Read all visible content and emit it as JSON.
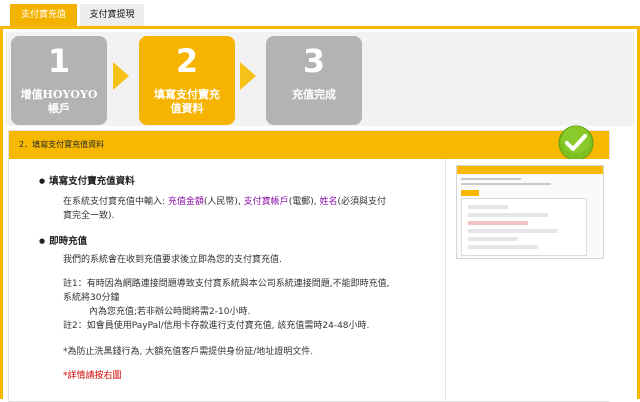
{
  "tabs": [
    {
      "label": "支付寶充值",
      "active": true
    },
    {
      "label": "支付寶提現",
      "active": false
    }
  ],
  "steps": [
    {
      "number": "1",
      "label_line1": "增值HOYOYO",
      "label_line2": "帳戶",
      "state": "done"
    },
    {
      "number": "2",
      "label_line1": "填寫支付寶充",
      "label_line2": "值資料",
      "state": "current"
    },
    {
      "number": "3",
      "label_line1": "充值完成",
      "label_line2": "",
      "state": "pending"
    }
  ],
  "section": {
    "header": "2．填寫支付寶充值資料",
    "bullet1_title": "填寫支付寶充值資料",
    "bullet1_text_prefix": "在系統支付寶充值中輸入: ",
    "bullet1_link_amount": "充值金額",
    "bullet1_text_rmb": "(人民幣), ",
    "bullet1_link_account": "支付寶帳戶",
    "bullet1_text_email": "(電郵), ",
    "bullet1_link_name": "姓名",
    "bullet1_text_suffix": "(必須與支付",
    "bullet1_text_line2": "寶完全一致).",
    "bullet2_title": "即時充值",
    "bullet2_text": "我們的系統會在收到充值要求後立即為您的支付寶充值.",
    "note1_line1": "註1：有時因為網路連接問題導致支付寶系統與本公司系統連接問題,不能即時充值,",
    "note1_line2": "系統將30分鐘",
    "note1_line3": "內為您充值;若非辦公時間將需2-10小時.",
    "note2": "註2：如會員使用PayPal/信用卡存款進行支付寶充值, 該充值需時24-48小時.",
    "warning": "*為防止洗黑錢行為, 大額充值客戶需提供身份証/地址證明文件.",
    "detail_link": "*詳情請按右圖"
  },
  "colors": {
    "accent": "#f6b800",
    "step_inactive": "#b3b3b3",
    "link": "#8b0fa8",
    "red": "#d40000"
  },
  "icons": {
    "check": "check-circle-icon",
    "arrow": "chevron-right-icon"
  }
}
